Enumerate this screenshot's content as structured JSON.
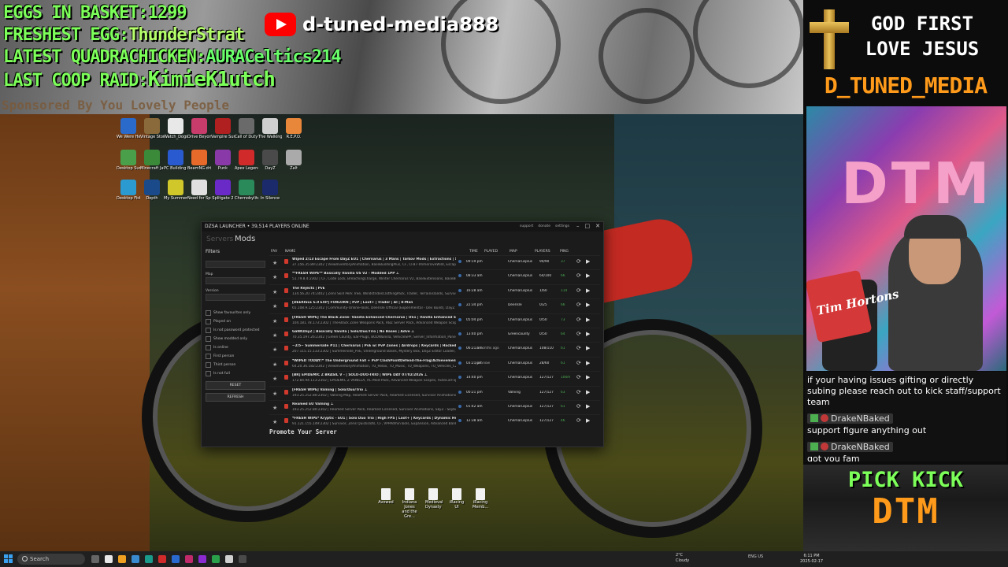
{
  "overlay": {
    "eggs_label": "EGGS IN BASKET:",
    "eggs_value": "1299",
    "freshest_label": "FRESHEST EGG:",
    "freshest_value": "ThunderStrat",
    "latest_label": "LATEST QUADRACHICKEN:",
    "latest_value": "AURACeltics214",
    "raid_label": "LAST COOP RAID:",
    "raid_value": "KimieK1utch",
    "sponsored": "Sponsored By You Lovely People",
    "youtube_channel": "d-tuned-media888",
    "god_line1": "GOD FIRST",
    "god_line2": "LOVE JESUS",
    "brand": "D_TUNED_MEDIA",
    "pick_line1": "PICK KICK",
    "pick_line2": "DTM",
    "webcam_sign": "DTM",
    "webcam_cup": "Tim Hortons"
  },
  "chat": {
    "intro": "if your having issues gifting or directly subing please reach out to kick staff/support team",
    "messages": [
      {
        "user": "DrakeNBaked",
        "text": "support figure anything out"
      },
      {
        "user": "DrakeNBaked",
        "text": "got you fam"
      }
    ]
  },
  "desktop_icons": [
    {
      "label": "We Were Here Bo...",
      "color": "#2a6acb"
    },
    {
      "label": "Vintage Story",
      "color": "#8a6a3a"
    },
    {
      "label": "Watch_Dogs",
      "color": "#e8e8e8"
    },
    {
      "label": "Drive Beyond Horizons",
      "color": "#c83c6c"
    },
    {
      "label": "Vampire Survivors",
      "color": "#b02020"
    },
    {
      "label": "Call of Duty®",
      "color": "#6a6a6a"
    },
    {
      "label": "The Walking Dead The...",
      "color": "#cfcfcf"
    },
    {
      "label": "R.E.P.O.",
      "color": "#e8863a"
    },
    {
      "label": "Desktop Survivors 98",
      "color": "#4aa04a"
    },
    {
      "label": "Minecraft Java Edition",
      "color": "#3a8a3a"
    },
    {
      "label": "PC Building Simulator 2",
      "color": "#2a5ad0"
    },
    {
      "label": "BeamNG.drive",
      "color": "#e86a2a"
    },
    {
      "label": "Punk",
      "color": "#8a3aa8"
    },
    {
      "label": "Apex Legends",
      "color": "#d02a2a"
    },
    {
      "label": "DayZ",
      "color": "#4a4a4a"
    },
    {
      "label": "Zalt",
      "color": "#aaaaaa"
    },
    {
      "label": "Desktop Fishing",
      "color": "#2a9ad0"
    },
    {
      "label": "Depth",
      "color": "#1a4a8a"
    },
    {
      "label": "My Summer Car",
      "color": "#d0c82a"
    },
    {
      "label": "Need for Speed™...",
      "color": "#e0e0e0"
    },
    {
      "label": "Splitgate 2",
      "color": "#6a2ac8"
    },
    {
      "label": "Chernobylite Complete...",
      "color": "#2a8a5a"
    },
    {
      "label": "In Silence",
      "color": "#1a2a6a"
    }
  ],
  "bottom_icons": [
    {
      "label": "Avowed"
    },
    {
      "label": "Indiana Jones and the Gre..."
    },
    {
      "label": "Medieval Dynasty"
    },
    {
      "label": "iRacing UI"
    },
    {
      "label": "iRacing Memb..."
    }
  ],
  "launcher": {
    "title": "DZSA LAUNCHER • 39,514 PLAYERS ONLINE",
    "links": [
      "support",
      "donate",
      "settings"
    ],
    "controls": [
      "–",
      "□",
      "✕"
    ],
    "tab_dim": "Servers",
    "tab_active": "Mods",
    "filters": {
      "heading": "Filters",
      "map_label": "Map",
      "version_label": "Version",
      "checkboxes": [
        "Show favourites only",
        "Played on",
        "Is not password protected",
        "Show modded only",
        "Is online",
        "First person",
        "Third person",
        "Is not full"
      ],
      "reset": "RESET",
      "refresh": "REFRESH"
    },
    "columns": {
      "fav": "FAV",
      "name": "NAME",
      "time": "TIME",
      "played": "PLAYED",
      "map": "MAP",
      "players": "PLAYERS",
      "ping": "PING"
    },
    "servers": [
      {
        "name": "Wiped 2/13 Escape From DayZ EU1 | Chernarus | 3 Mans | Tarkov Mods | Extractions | Secure",
        "detail": "37.156.35.89:2302 | ViewInventoryAnimation, BaseBuildingPlus, CF, CF87-ImmersiveWild, Escape Fr",
        "time": "09:19 pm",
        "played": "",
        "map": "Chernarusplus",
        "players": "90/90",
        "ping": "37"
      },
      {
        "name": "**FRESH WIPE** Basically Vanilla US V2 - Modded 1PP ⊥",
        "detail": "51.79.8.4:2302 | CF, Code Lock, BreachingCharge, Winter Chernarus V2, BaseExtensions, BaseBuild",
        "time": "08:33 am",
        "played": "",
        "map": "Chernarusplus",
        "players": "64/100",
        "ping": "66"
      },
      {
        "name": "The Rejects | PvE",
        "detail": "134.56.20.74:2402 | Zens Skill Perk Tree, WindstridesClothingPack, Trader, Terrainislands, Survivor",
        "time": "16:28 am",
        "played": "",
        "map": "Chernarusplus",
        "players": "1/60",
        "ping": "114"
      },
      {
        "name": "[DEERISLE 6.0 EXP] FORLORN | PvP | Loot+ | Trader | AI | 8-Man",
        "detail": "65.108.9.125:2302 | Community-Online-Tools, Deerisle Official (Experimental - Dev Build), DayZ E",
        "time": "22:34 pm",
        "played": "",
        "map": "Deerisle",
        "players": "0/25",
        "ping": "66"
      },
      {
        "name": "[FRESH WIPE] The Black Zone- Vanilla Enhanced Chernarus | US1 | Vanilla Enhanced Survival",
        "detail": "104.181.78.173:2302 | The-Black Zone Weapons Pack, RBZ Server Pack, Advanced Weapon Scopes",
        "time": "05:04 pm",
        "played": "",
        "map": "Chernarusplus",
        "players": "0/50",
        "ping": "73"
      },
      {
        "name": "GaNKDayZ | Basically Vanilla | Solo/Duo/Trio | No Bases | Adve ⊥",
        "detail": "70.35.197.26:2302 | Green County, Ear-Plugs, BODWanilla, VehicleSPP, Server_Information_Panel, L",
        "time": "13:40 pm",
        "played": "",
        "map": "Greencounty",
        "players": "0/50",
        "ping": "64"
      },
      {
        "name": "~2/5~ Summerside #11 | Chernarus | PvE w/ PvP Zones | Airdrops | Keycards | Hacked Crates | 30+",
        "detail": "207.115.15.133:2302 | Summerside_PvE, Underground Bases, Mystery Box, DayZ Editor Loader, Vehicle 3",
        "time": "06:21 am",
        "played": "3 months ago",
        "map": "Chernarusplus",
        "players": "108/110",
        "ping": "61"
      },
      {
        "name": "*WIPED TODAY!* The Underground Fall + PvP ClashPointDefend-The-Flag/Achievements[BE",
        "detail": "64.20.36.182:2302 | ViewInventoryAnimation, TU_Relax, TU_Music, TU_Weapons, TU_Vehicles_CZ, TU_Vehicles_MER",
        "time": "03:21 pm",
        "played": "just now",
        "map": "Chernarusplus",
        "players": "28/60",
        "ping": "61"
      },
      {
        "name": "[BR] EPIDEMIC Z BRASIL V - | SOLO-DUO-TRIO | WIPE DAY 07/02/2026 ⊥",
        "detail": "172.84.94.113:2302 | EPIDEMIC Z VANILLA, AC-Mod-Pack, Advanced Weapon Scopes, AutoCarFlip, Ba",
        "time": "14:40 pm",
        "played": "",
        "map": "Chernarusplus",
        "players": "127/127",
        "ping": "100ms"
      },
      {
        "name": "[FRESH WIPE] Valning | Solo/Duo/Trio ⊥",
        "detail": "193.25.252.80:2302 | Valning Map, Reamed Server Pack, Reamed Licensed, Survivor Animations, SkyZ",
        "time": "00:21 pm",
        "played": "",
        "map": "Valning",
        "players": "127/127",
        "ping": "63"
      },
      {
        "name": "Reamed EU Valning ⊥",
        "detail": "193.25.252.80:2302 | Reamed Server Pack, Reamed Licensed, Survivor Animations, SkyZ - Skybox Ov",
        "time": "01:42 am",
        "played": "",
        "map": "Chernarusplus",
        "players": "127/127",
        "ping": "61"
      },
      {
        "name": "*FRESH WIPE* Kryptic - EU1 | Solo Duo Trio | High FPS | Loot+ | Keycards | Dynamic Heli Crash",
        "detail": "91.121.155.149:2302 | Survivor, Zens Quickslots, CF, VPPAdminTools, Expansion, Advanced Banking",
        "time": "12:38 am",
        "played": "",
        "map": "Chernarusplus",
        "players": "127/127",
        "ping": "46"
      }
    ],
    "promote": "Promote Your Server"
  },
  "taskbar": {
    "search": "Search",
    "weather_temp": "2°C",
    "weather_desc": "Cloudy",
    "tray": "ENG US",
    "time": "6:11 PM",
    "date": "2025-02-17"
  }
}
